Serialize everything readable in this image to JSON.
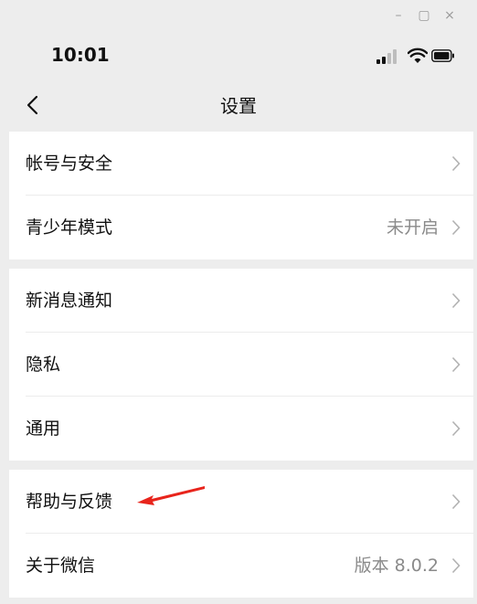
{
  "window": {
    "minimize_icon": "–",
    "maximize_icon": "▢",
    "close_icon": "×"
  },
  "status_bar": {
    "time": "10:01"
  },
  "nav": {
    "title": "设置"
  },
  "groups": [
    {
      "items": [
        {
          "label": "帐号与安全",
          "value": ""
        },
        {
          "label": "青少年模式",
          "value": "未开启"
        }
      ]
    },
    {
      "items": [
        {
          "label": "新消息通知",
          "value": ""
        },
        {
          "label": "隐私",
          "value": ""
        },
        {
          "label": "通用",
          "value": ""
        }
      ]
    },
    {
      "items": [
        {
          "label": "帮助与反馈",
          "value": ""
        },
        {
          "label": "关于微信",
          "value": "版本 8.0.2"
        }
      ]
    }
  ],
  "annotation": {
    "color": "#e8241c"
  }
}
